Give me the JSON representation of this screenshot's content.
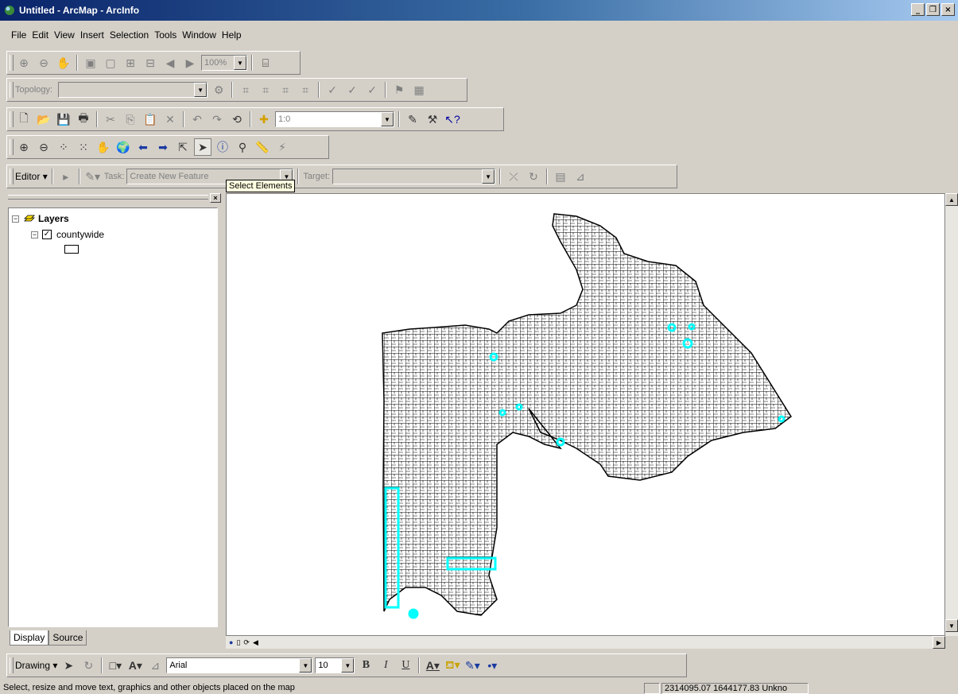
{
  "window": {
    "title": "Untitled - ArcMap - ArcInfo",
    "controls": [
      "_",
      "❒",
      "×"
    ]
  },
  "menu": [
    "File",
    "Edit",
    "View",
    "Insert",
    "Selection",
    "Tools",
    "Window",
    "Help"
  ],
  "layout_toolbar": {
    "zoom_value": "100%"
  },
  "topology_toolbar": {
    "label": "Topology:",
    "value": ""
  },
  "standard_toolbar": {
    "scale_value": "1:0"
  },
  "editor_toolbar": {
    "editor_label": "Editor",
    "task_label": "Task:",
    "task_value": "Create New Feature",
    "target_label": "Target:",
    "target_value": ""
  },
  "tooltip": "Select Elements",
  "toc": {
    "root_label": "Layers",
    "layer_name": "countywide",
    "tabs": [
      "Display",
      "Source"
    ]
  },
  "drawing_toolbar": {
    "drawing_label": "Drawing",
    "font_name": "Arial",
    "font_size": "10",
    "bold": "B",
    "italic": "I",
    "underline": "U",
    "text_color_glyph": "A"
  },
  "status": {
    "message": "Select, resize and move text, graphics and other objects placed on the map",
    "coordinates": "2314095.07  1644177.83 Unkno"
  },
  "colors": {
    "selection": "#00ffff",
    "title_start": "#0a246a",
    "title_end": "#a6caf0"
  }
}
